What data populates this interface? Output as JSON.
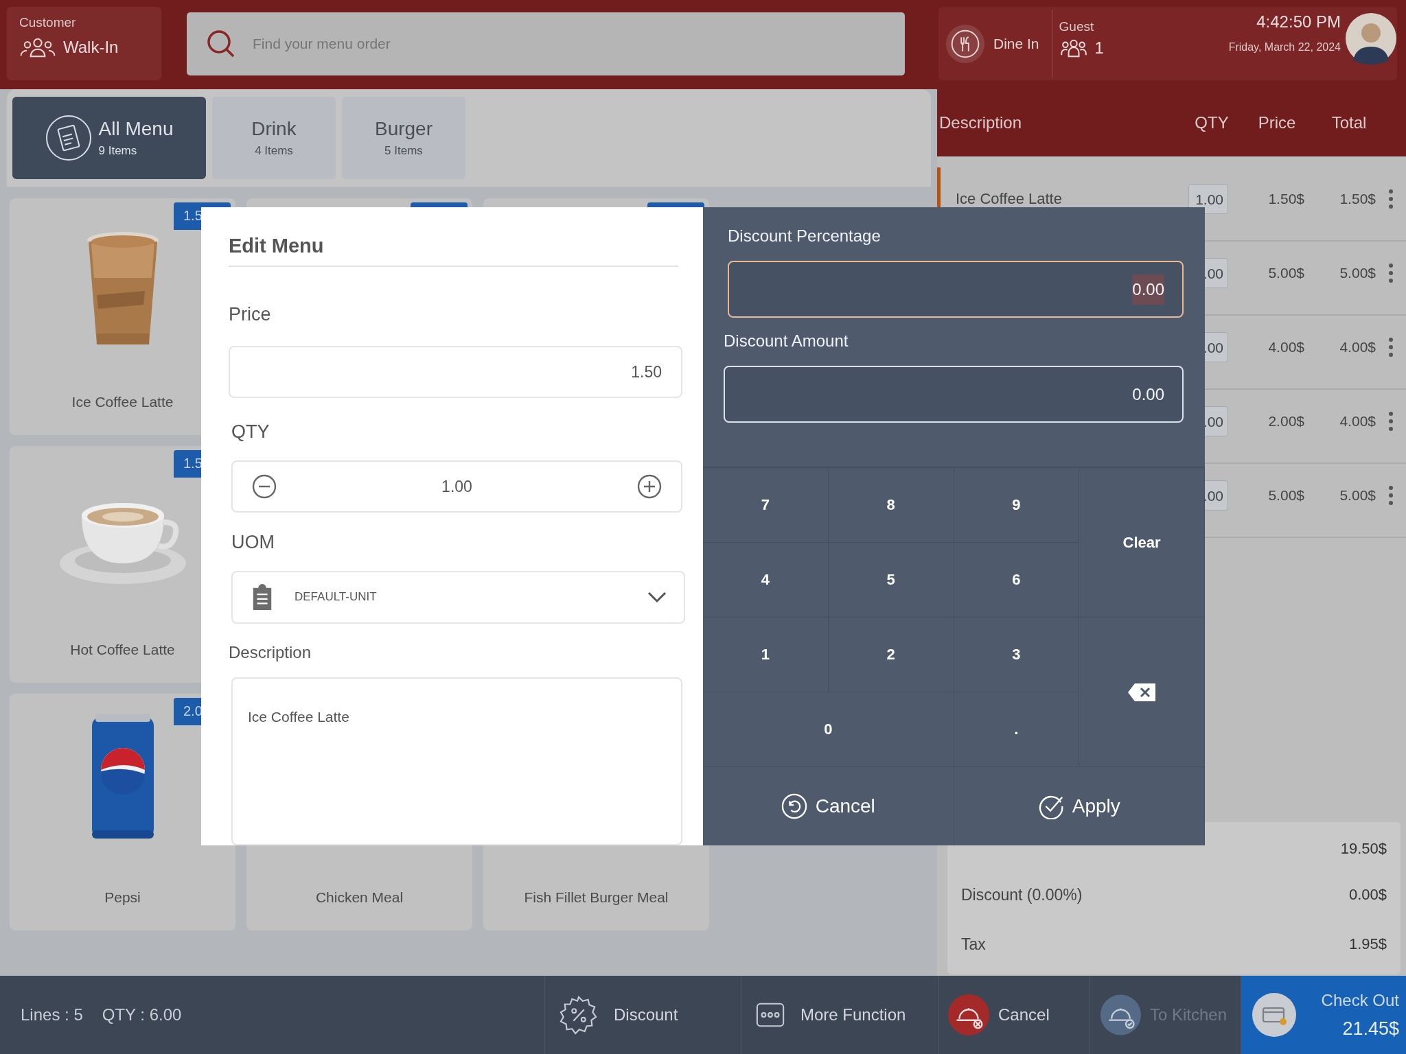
{
  "customer": {
    "label": "Customer",
    "value": "Walk-In"
  },
  "search": {
    "placeholder": "Find your menu order"
  },
  "order_info": {
    "dine": "Dine In",
    "guest_label": "Guest",
    "guest_count": "1",
    "time": "4:42:50 PM",
    "date": "Friday, March 22, 2024"
  },
  "categories": [
    {
      "name": "All Menu",
      "count": "9 Items",
      "selected": true
    },
    {
      "name": "Drink",
      "count": "4 Items",
      "selected": false
    },
    {
      "name": "Burger",
      "count": "5 Items",
      "selected": false
    }
  ],
  "product_rows": [
    [
      {
        "name": "Ice Coffee Latte",
        "badge": "1.5",
        "kind": "picture"
      },
      {
        "price_tag": true
      },
      {
        "price_tag": true
      }
    ],
    [
      {
        "name": "Hot Coffee Latte",
        "badge": "1.5",
        "kind": "picture"
      }
    ],
    [
      {
        "name": "Pepsi",
        "badge": "2.0",
        "kind": "picture"
      },
      {
        "name": "Chicken Meal"
      },
      {
        "name": "Fish Fillet Burger Meal"
      }
    ]
  ],
  "order_table": {
    "columns": [
      "Description",
      "QTY",
      "Price",
      "Total"
    ],
    "rows": [
      {
        "description": "Ice Coffee Latte",
        "qty": "1.00",
        "price": "1.50$",
        "total": "1.50$",
        "selected": true
      },
      {
        "qty": ".00",
        "price": "5.00$",
        "total": "5.00$"
      },
      {
        "qty": ".00",
        "price": "4.00$",
        "total": "4.00$"
      },
      {
        "qty": ".00",
        "price": "2.00$",
        "total": "4.00$"
      },
      {
        "qty": ".00",
        "price": "5.00$",
        "total": "5.00$"
      }
    ]
  },
  "summary": [
    {
      "value": "19.50$"
    },
    {
      "label": "Discount (0.00%)",
      "value": "0.00$"
    },
    {
      "label": "Tax",
      "value": "1.95$"
    }
  ],
  "status": {
    "lines": "Lines : 5",
    "qty": "QTY : 6.00"
  },
  "actions": [
    {
      "kind": "discount",
      "label": "Discount",
      "disabled": false
    },
    {
      "kind": "more",
      "label": "More Function",
      "disabled": false
    },
    {
      "kind": "cancel",
      "label": "Cancel",
      "disabled": false
    },
    {
      "kind": "kitchen",
      "label": "To Kitchen",
      "disabled": true
    },
    {
      "kind": "checkout",
      "label": "Check Out",
      "amount": "21.45$",
      "disabled": false
    }
  ],
  "edit_menu": {
    "title": "Edit Menu",
    "price_label": "Price",
    "price": "1.50",
    "qty_label": "QTY",
    "qty": "1.00",
    "uom_label": "UOM",
    "uom": "DEFAULT-UNIT",
    "description_label": "Description",
    "description": "Ice Coffee Latte"
  },
  "discount": {
    "fields": [
      {
        "label": "Discount Percentage",
        "value": "0.00",
        "focused": true
      },
      {
        "label": "Discount Amount",
        "value": "0.00",
        "focused": false
      }
    ],
    "keys": [
      {
        "kind": "digit",
        "label": "7"
      },
      {
        "kind": "digit",
        "label": "8"
      },
      {
        "kind": "digit",
        "label": "9"
      },
      {
        "kind": "clear",
        "label": "Clear"
      },
      {
        "kind": "digit",
        "label": "4"
      },
      {
        "kind": "digit",
        "label": "5"
      },
      {
        "kind": "digit",
        "label": "6"
      },
      {
        "kind": "digit",
        "label": "1"
      },
      {
        "kind": "digit",
        "label": "2"
      },
      {
        "kind": "digit",
        "label": "3"
      },
      {
        "kind": "backspace"
      },
      {
        "kind": "wide",
        "label": "0"
      },
      {
        "kind": "digit",
        "label": "."
      }
    ],
    "buttons": [
      {
        "kind": "cancel",
        "label": "Cancel"
      },
      {
        "kind": "apply",
        "label": "Apply"
      }
    ]
  }
}
